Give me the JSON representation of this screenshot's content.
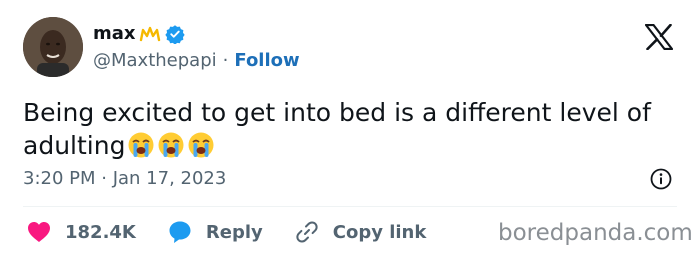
{
  "author": {
    "display_name": "max",
    "name_emoji": "crown-emoji",
    "verified_icon": "verified-badge-icon",
    "handle": "@Maxthepapi",
    "separator": "·",
    "follow_label": "Follow"
  },
  "tweet": {
    "text_line": "Being excited to get into bed is a different level of",
    "text_word": "adulting",
    "emojis": [
      "loudly-crying-face",
      "loudly-crying-face",
      "loudly-crying-face"
    ],
    "timestamp": "3:20 PM · Jan 17, 2023"
  },
  "actions": {
    "likes": "182.4K",
    "reply_label": "Reply",
    "copy_link_label": "Copy link"
  },
  "watermark": "boredpanda.com",
  "colors": {
    "text": "#0f1419",
    "secondary": "#536471",
    "follow_blue": "#1d6fb8",
    "verified_blue": "#1d9bf0",
    "heart_pink": "#f91880",
    "reply_blue": "#1d9bf0",
    "crown_yellow": "#f5b800"
  }
}
